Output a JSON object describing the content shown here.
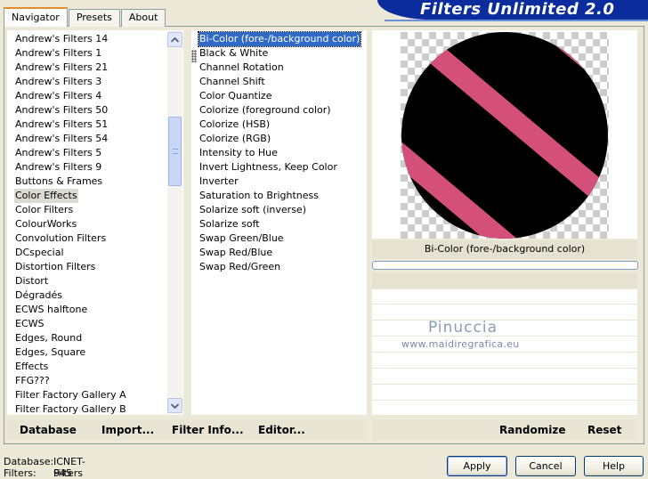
{
  "window": {
    "banner_title": "Filters Unlimited 2.0",
    "colors": {
      "banner": "#0a2c9c",
      "selection": "#316ac5",
      "pink": "#d4507a"
    }
  },
  "tabs": [
    {
      "label": "Navigator",
      "active": true
    },
    {
      "label": "Presets",
      "active": false
    },
    {
      "label": "About",
      "active": false
    }
  ],
  "categories": {
    "items": [
      "Andrew's Filters 14",
      "Andrew's Filters 1",
      "Andrew's Filters 21",
      "Andrew's Filters 3",
      "Andrew's Filters 4",
      "Andrew's Filters 50",
      "Andrew's Filters 51",
      "Andrew's Filters 54",
      "Andrew's Filters 5",
      "Andrew's Filters 9",
      "Buttons & Frames",
      "Color Effects",
      "Color Filters",
      "ColourWorks",
      "Convolution Filters",
      "DCspecial",
      "Distortion Filters",
      "Distort",
      "Dégradés",
      "ECWS halftone",
      "ECWS",
      "Edges, Round",
      "Edges, Square",
      "Effects",
      "FFG???",
      "Filter Factory Gallery A",
      "Filter Factory Gallery B"
    ],
    "selected": "Color Effects"
  },
  "filters": {
    "items": [
      "Bi-Color (fore-/background color)",
      "Black & White",
      "Channel Rotation",
      "Channel Shift",
      "Color Quantize",
      "Colorize (foreground color)",
      "Colorize (HSB)",
      "Colorize (RGB)",
      "Intensity to Hue",
      "Invert Lightness, Keep Color",
      "Inverter",
      "Saturation to Brightness",
      "Solarize soft (inverse)",
      "Solarize soft",
      "Swap Green/Blue",
      "Swap Red/Blue",
      "Swap Red/Green"
    ],
    "selected": "Bi-Color (fore-/background color)"
  },
  "preview": {
    "caption": "Bi-Color (fore-/background color)",
    "progress": 0
  },
  "watermark": {
    "name": "Pinuccia",
    "url": "www.maidiregrafica.eu"
  },
  "toolbar": {
    "database": "Database",
    "import": "Import...",
    "filter_info": "Filter Info...",
    "editor": "Editor...",
    "randomize": "Randomize",
    "reset": "Reset"
  },
  "status": {
    "database_label": "Database:",
    "database_value": "ICNET-Filters",
    "filters_label": "Filters:",
    "filters_value": "945"
  },
  "buttons": {
    "apply": "Apply",
    "cancel": "Cancel",
    "help": "Help"
  }
}
